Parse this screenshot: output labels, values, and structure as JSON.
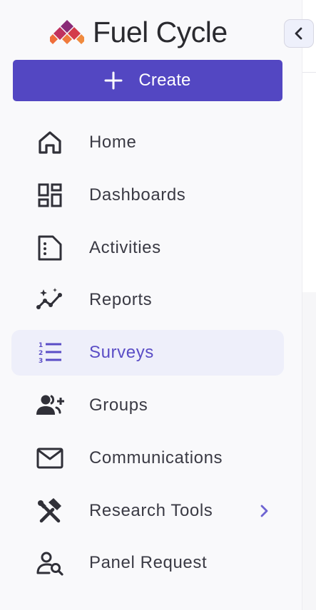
{
  "logo": {
    "text": "Fuel Cycle",
    "icon": "fuel-cycle-diamond-logo",
    "colors": [
      "#8a2a77",
      "#d43c4a",
      "#f07a3c"
    ]
  },
  "collapse_button": {
    "icon": "chevron-left-icon"
  },
  "create_button": {
    "label": "Create",
    "icon": "plus-icon",
    "color": "#5347c2"
  },
  "nav": {
    "active_color": "#5a4dc6",
    "items": [
      {
        "label": "Home",
        "icon": "home-icon"
      },
      {
        "label": "Dashboards",
        "icon": "dashboard-icon"
      },
      {
        "label": "Activities",
        "icon": "activities-icon"
      },
      {
        "label": "Reports",
        "icon": "reports-trend-icon"
      },
      {
        "label": "Surveys",
        "icon": "numbered-list-icon",
        "active": true
      },
      {
        "label": "Groups",
        "icon": "add-group-icon"
      },
      {
        "label": "Communications",
        "icon": "mail-icon"
      },
      {
        "label": "Research Tools",
        "icon": "tools-icon",
        "has_submenu": true
      },
      {
        "label": "Panel Request",
        "icon": "user-search-icon"
      }
    ]
  }
}
